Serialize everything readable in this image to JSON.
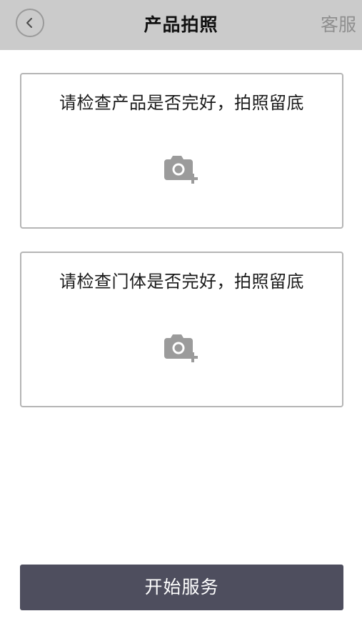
{
  "header": {
    "title": "产品拍照",
    "support_label": "客服"
  },
  "cards": [
    {
      "label": "请检查产品是否完好，拍照留底"
    },
    {
      "label": "请检查门体是否完好，拍照留底"
    }
  ],
  "footer": {
    "start_label": "开始服务"
  },
  "icons": {
    "back": "chevron-left-icon",
    "camera": "camera-plus-icon"
  },
  "colors": {
    "header_bg": "#cbcbcb",
    "button_bg": "#4e4e5e",
    "icon_gray": "#9b9b9b"
  }
}
